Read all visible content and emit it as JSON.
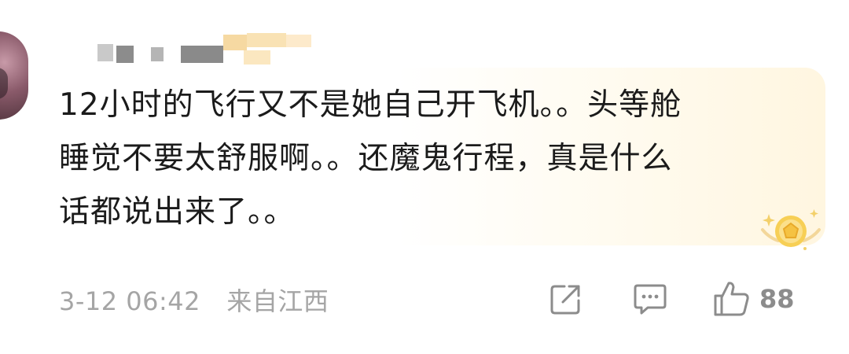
{
  "comment": {
    "username_masked": "",
    "text": "12小时的飞行又不是她自己开飞机。。头等舱\n睡觉不要太舒服啊。。还魔鬼行程，真是什么\n话都说出来了。。",
    "date": "3-12 06:42",
    "location": "来自江西",
    "like_count": "88"
  },
  "icons": {
    "share": "share-icon",
    "comment": "comment-icon",
    "like": "thumbs-up-icon",
    "badge": "vip-badge-icon",
    "avatar": "avatar"
  },
  "colors": {
    "text": "#1b1b1b",
    "meta": "#a5a5a5",
    "icon": "#8c8c8c",
    "badge_gold": "#f5c242",
    "bubble_tint": "#fff6e0"
  }
}
